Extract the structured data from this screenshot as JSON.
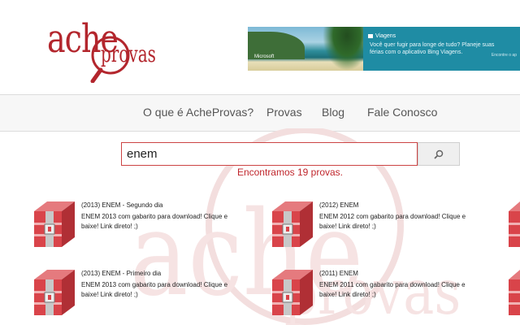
{
  "logo": {
    "part1": "ache",
    "part2": "provas"
  },
  "ad": {
    "brand": "Microsoft",
    "title": "Viagens",
    "text": "Você quer fugir para longe de tudo? Planeje suas férias com o aplicativo Bing Viagens.",
    "cta": "Encontre o ap"
  },
  "nav": {
    "items": [
      {
        "label": "O que é AcheProvas?"
      },
      {
        "label": "Provas"
      },
      {
        "label": "Blog"
      },
      {
        "label": "Fale Conosco"
      }
    ]
  },
  "search": {
    "value": "enem",
    "button_icon": "search-icon",
    "result_count": "Encontramos 19 provas."
  },
  "results": [
    {
      "title": "(2013) ENEM - Segundo dia",
      "desc": "ENEM 2013 com gabarito para download! Clique e baixe! Link direto! ;)"
    },
    {
      "title": "(2012) ENEM",
      "desc": "ENEM 2012 com gabarito para download! Clique e baixe! Link direto! ;)"
    },
    {
      "title": "(2013) ENEM - Primeiro dia",
      "desc": "ENEM 2013 com gabarito para download! Clique e baixe! Link direto! ;)"
    },
    {
      "title": "(2011) ENEM",
      "desc": "ENEM 2011 com gabarito para download! Clique e baixe! Link direto! ;)"
    }
  ],
  "colors": {
    "brand": "#b3262d",
    "ad_bg": "#1f8ca4",
    "nav_bg": "#f7f7f7",
    "book_red": "#d9444a"
  }
}
